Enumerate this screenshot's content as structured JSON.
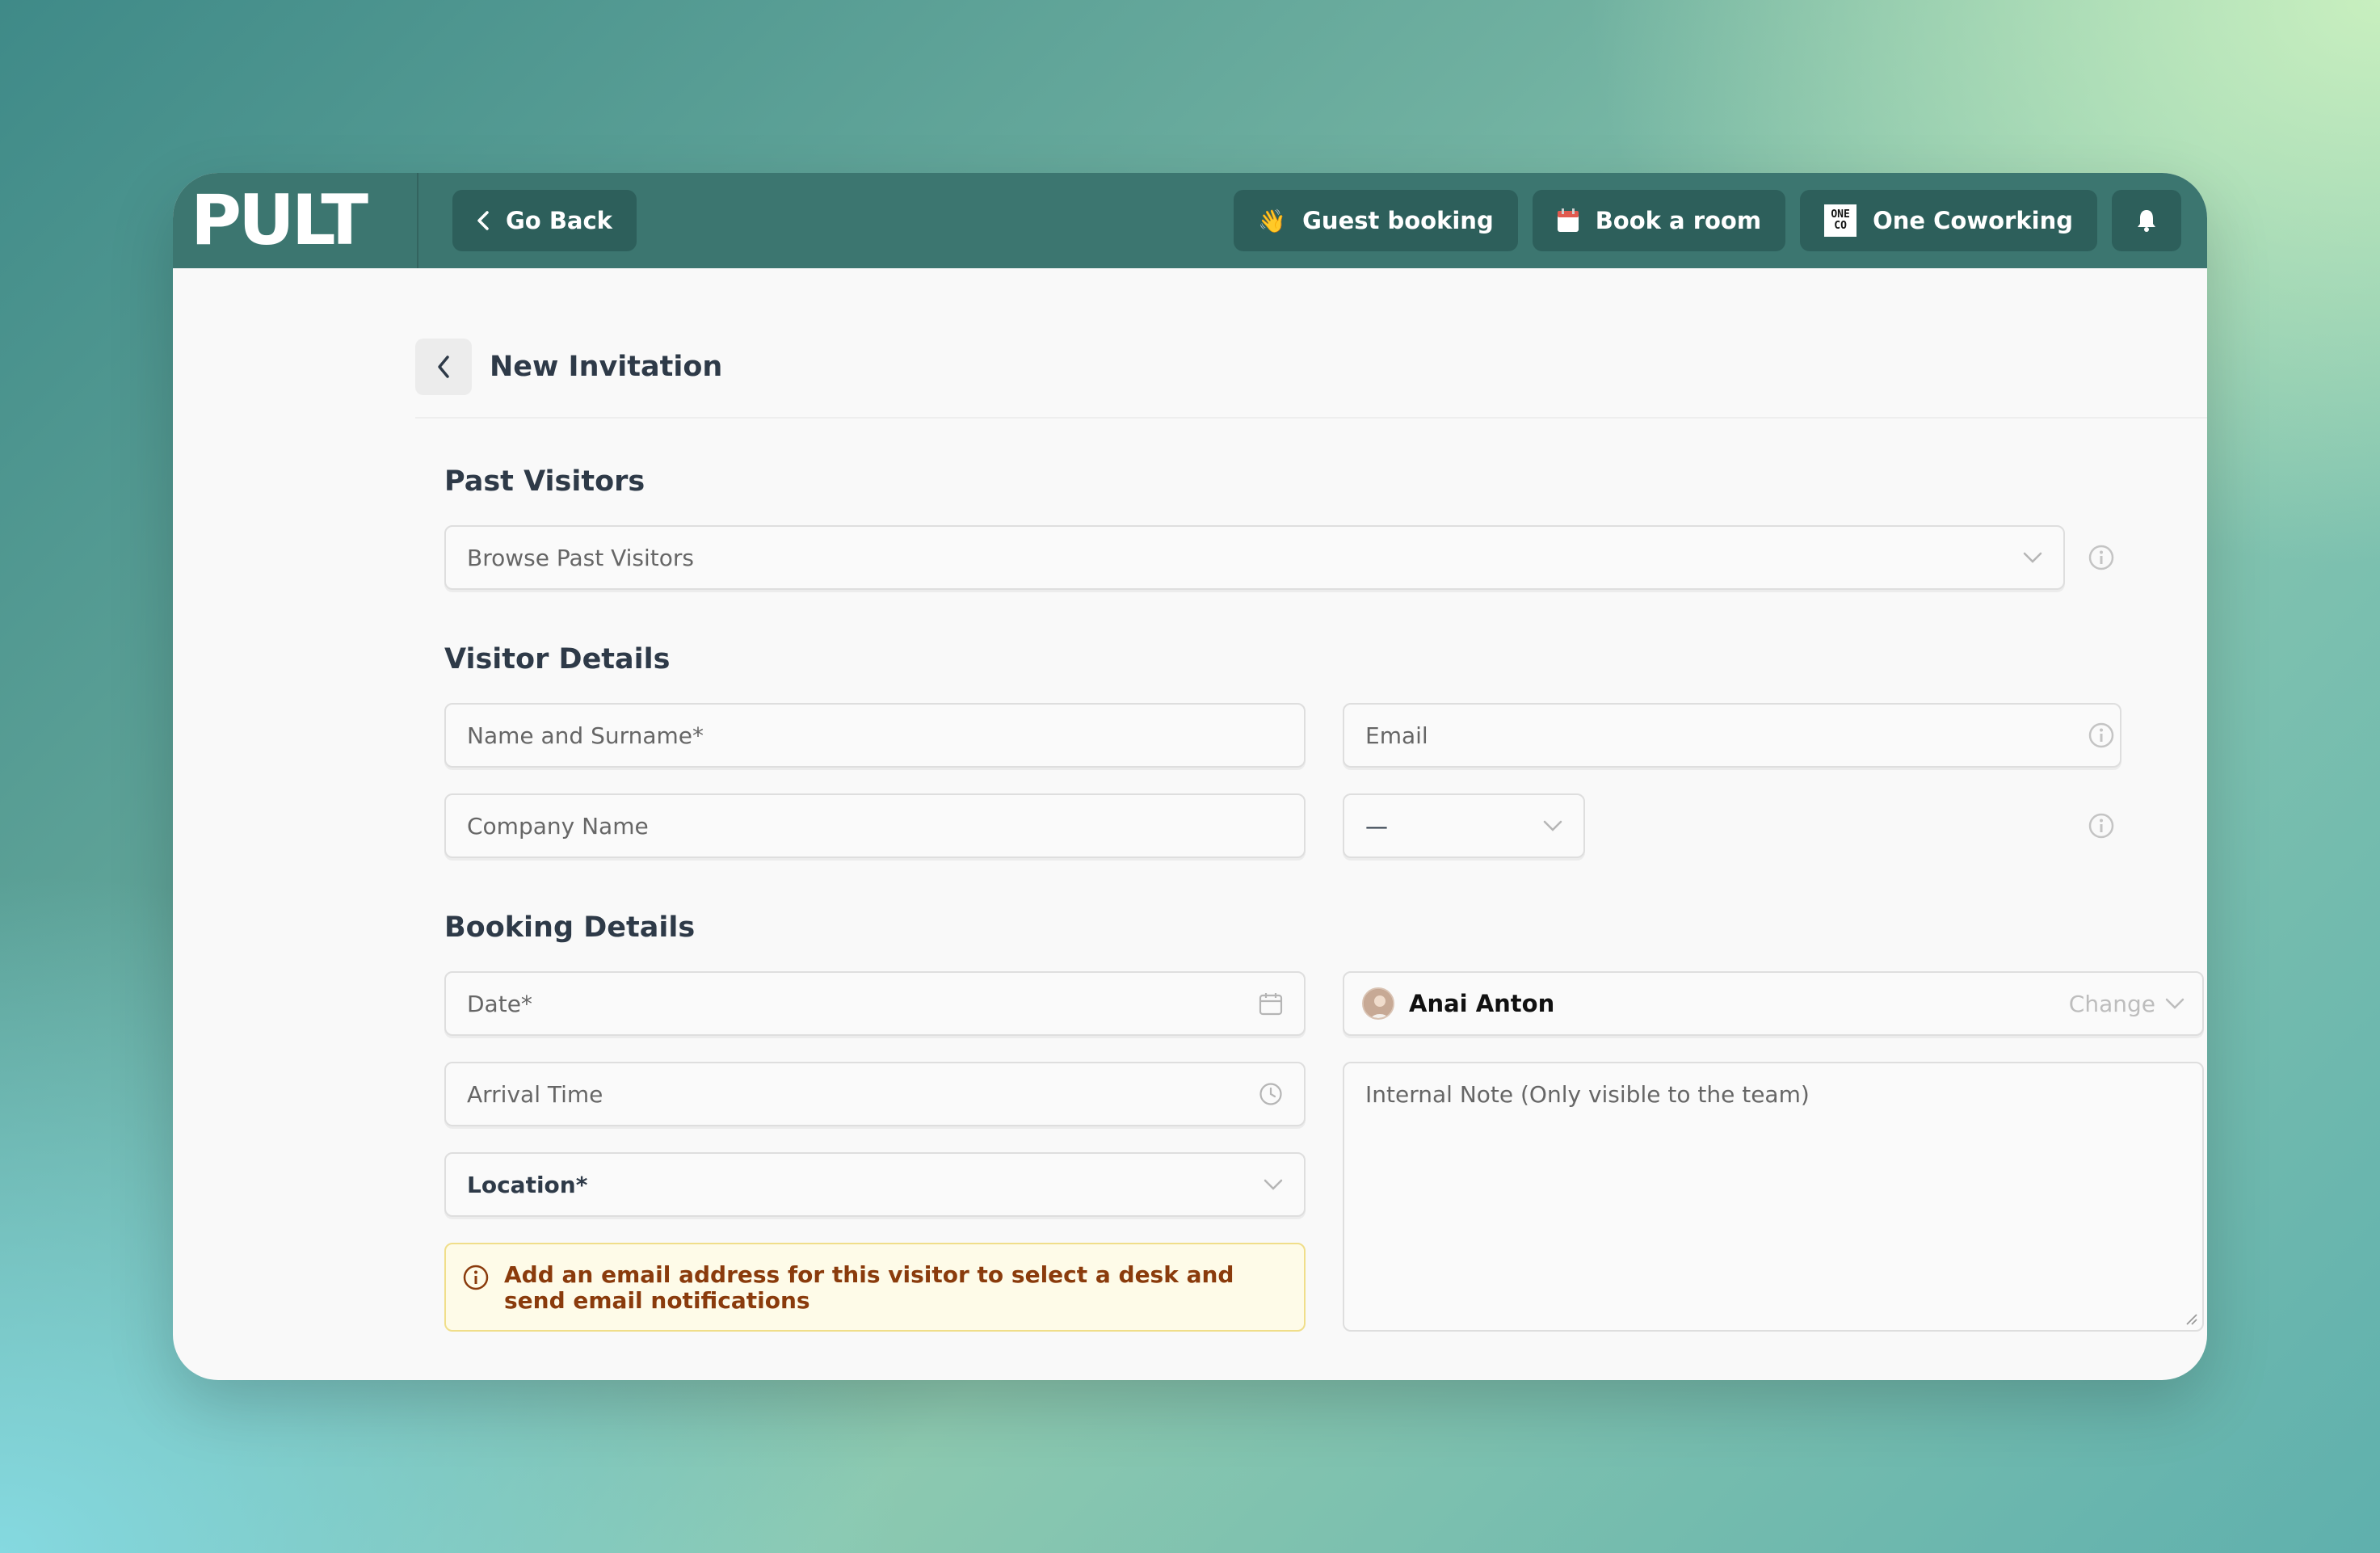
{
  "topbar": {
    "logo": "PULT",
    "go_back": "Go Back",
    "guest_booking": "Guest booking",
    "guest_booking_emoji": "👋",
    "book_room": "Book a room",
    "book_room_emoji": "🗓️",
    "one_coworking": "One Coworking",
    "oneco_icon_top": "ONE",
    "oneco_icon_bottom": "CO"
  },
  "page": {
    "title": "New Invitation"
  },
  "past_visitors": {
    "title": "Past Visitors",
    "select_placeholder": "Browse Past Visitors"
  },
  "visitor_details": {
    "title": "Visitor Details",
    "name_placeholder": "Name and Surname*",
    "email_placeholder": "Email",
    "company_placeholder": "Company Name",
    "phone_prefix_value": "—"
  },
  "booking_details": {
    "title": "Booking Details",
    "date_placeholder": "Date*",
    "arrival_placeholder": "Arrival Time",
    "location_label": "Location*",
    "alert_text": "Add an email address for this visitor to select a desk and send email notifications",
    "host_name": "Anai Anton",
    "change_label": "Change",
    "note_placeholder": "Internal Note (Only visible to the team)"
  },
  "colors": {
    "topbar": "#3c7670",
    "button_dark": "#2d5f5b",
    "alert_bg": "#fefbe8",
    "alert_text": "#8a3b0c"
  }
}
